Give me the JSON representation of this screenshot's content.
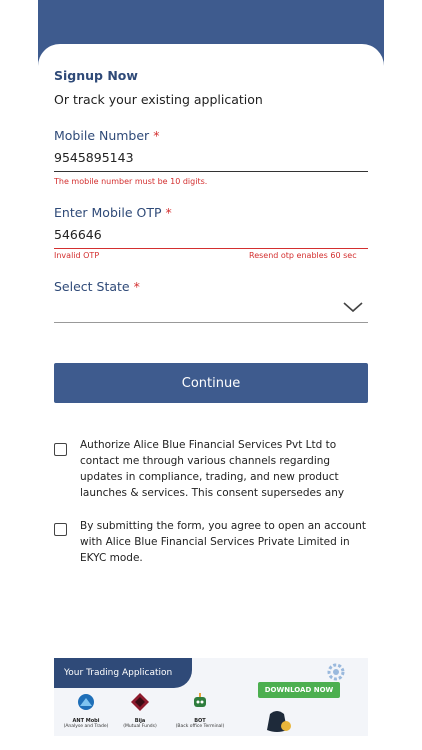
{
  "header": {
    "title": "Signup Now",
    "subtitle": "Or track your existing application"
  },
  "mobile": {
    "label": "Mobile Number",
    "required_mark": "*",
    "value": "9545895143",
    "error": "The mobile number must be 10 digits."
  },
  "otp": {
    "label": "Enter Mobile OTP",
    "required_mark": "*",
    "value": "546646",
    "error": "Invalid OTP",
    "resend_note": "Resend otp enables 60 sec"
  },
  "state": {
    "label": "Select State",
    "required_mark": "*",
    "selected_value": ""
  },
  "continue_label": "Continue",
  "consents": [
    {
      "text": "Authorize Alice Blue Financial Services Pvt Ltd to contact me through various channels regarding updates in compliance, trading, and new product launches & services. This consent supersedes any"
    },
    {
      "text": "By submitting the form, you agree to open an account with Alice Blue Financial Services Private Limited in EKYC mode."
    }
  ],
  "banner": {
    "title": "Your Trading Application",
    "download_label": "DOWNLOAD NOW",
    "apps": [
      {
        "name": "ANT Mobi",
        "sub": "(Analyse and Trade)",
        "icon": "ant-icon"
      },
      {
        "name": "Bija",
        "sub": "(Mutual Funds)",
        "icon": "bija-icon"
      },
      {
        "name": "BOT",
        "sub": "(Back office Terminal)",
        "icon": "bot-icon"
      }
    ]
  },
  "colors": {
    "primary": "#3e5b8e",
    "label": "#2f4a78",
    "error": "#d32f2f",
    "download": "#4caf50"
  },
  "icons": {
    "dropdown": "chevron-down-icon",
    "rupee": "rupee-bag-icon",
    "gear": "gear-icon"
  }
}
